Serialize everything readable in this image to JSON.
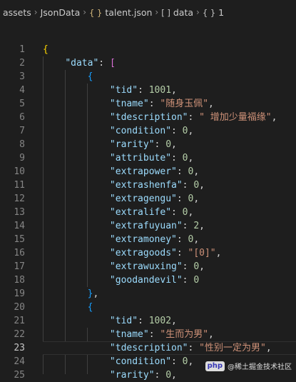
{
  "breadcrumb": {
    "items": [
      {
        "icon": "",
        "label": "assets"
      },
      {
        "icon": "",
        "label": "JsonData"
      },
      {
        "icon": "{ }",
        "label": "talent.json"
      },
      {
        "icon": "[ ]",
        "label": "data"
      },
      {
        "icon": "{ }",
        "label": "1"
      }
    ],
    "separator": "›"
  },
  "editor": {
    "active_line": 23,
    "lines": [
      {
        "n": "1",
        "t": [
          [
            "b1",
            "{"
          ]
        ]
      },
      {
        "n": "2",
        "t": [
          [
            "p",
            "    "
          ],
          [
            "k",
            "\"data\""
          ],
          [
            "p",
            ": "
          ],
          [
            "b2",
            "["
          ]
        ]
      },
      {
        "n": "3",
        "t": [
          [
            "p",
            "        "
          ],
          [
            "b3",
            "{"
          ]
        ]
      },
      {
        "n": "4",
        "t": [
          [
            "p",
            "            "
          ],
          [
            "k",
            "\"tid\""
          ],
          [
            "p",
            ": "
          ],
          [
            "n",
            "1001"
          ],
          [
            "p",
            ","
          ]
        ]
      },
      {
        "n": "5",
        "t": [
          [
            "p",
            "            "
          ],
          [
            "k",
            "\"tname\""
          ],
          [
            "p",
            ": "
          ],
          [
            "s",
            "\"随身玉佩\""
          ],
          [
            "p",
            ","
          ]
        ]
      },
      {
        "n": "6",
        "t": [
          [
            "p",
            "            "
          ],
          [
            "k",
            "\"tdescription\""
          ],
          [
            "p",
            ": "
          ],
          [
            "s",
            "\" 增加少量福缘\""
          ],
          [
            "p",
            ","
          ]
        ]
      },
      {
        "n": "7",
        "t": [
          [
            "p",
            "            "
          ],
          [
            "k",
            "\"condition\""
          ],
          [
            "p",
            ": "
          ],
          [
            "n",
            "0"
          ],
          [
            "p",
            ","
          ]
        ]
      },
      {
        "n": "8",
        "t": [
          [
            "p",
            "            "
          ],
          [
            "k",
            "\"rarity\""
          ],
          [
            "p",
            ": "
          ],
          [
            "n",
            "0"
          ],
          [
            "p",
            ","
          ]
        ]
      },
      {
        "n": "9",
        "t": [
          [
            "p",
            "            "
          ],
          [
            "k",
            "\"attribute\""
          ],
          [
            "p",
            ": "
          ],
          [
            "n",
            "0"
          ],
          [
            "p",
            ","
          ]
        ]
      },
      {
        "n": "10",
        "t": [
          [
            "p",
            "            "
          ],
          [
            "k",
            "\"extrapower\""
          ],
          [
            "p",
            ": "
          ],
          [
            "n",
            "0"
          ],
          [
            "p",
            ","
          ]
        ]
      },
      {
        "n": "11",
        "t": [
          [
            "p",
            "            "
          ],
          [
            "k",
            "\"extrashenfa\""
          ],
          [
            "p",
            ": "
          ],
          [
            "n",
            "0"
          ],
          [
            "p",
            ","
          ]
        ]
      },
      {
        "n": "12",
        "t": [
          [
            "p",
            "            "
          ],
          [
            "k",
            "\"extragengu\""
          ],
          [
            "p",
            ": "
          ],
          [
            "n",
            "0"
          ],
          [
            "p",
            ","
          ]
        ]
      },
      {
        "n": "13",
        "t": [
          [
            "p",
            "            "
          ],
          [
            "k",
            "\"extralife\""
          ],
          [
            "p",
            ": "
          ],
          [
            "n",
            "0"
          ],
          [
            "p",
            ","
          ]
        ]
      },
      {
        "n": "14",
        "t": [
          [
            "p",
            "            "
          ],
          [
            "k",
            "\"extrafuyuan\""
          ],
          [
            "p",
            ": "
          ],
          [
            "n",
            "2"
          ],
          [
            "p",
            ","
          ]
        ]
      },
      {
        "n": "15",
        "t": [
          [
            "p",
            "            "
          ],
          [
            "k",
            "\"extramoney\""
          ],
          [
            "p",
            ": "
          ],
          [
            "n",
            "0"
          ],
          [
            "p",
            ","
          ]
        ]
      },
      {
        "n": "16",
        "t": [
          [
            "p",
            "            "
          ],
          [
            "k",
            "\"extragoods\""
          ],
          [
            "p",
            ": "
          ],
          [
            "s",
            "\"[0]\""
          ],
          [
            "p",
            ","
          ]
        ]
      },
      {
        "n": "17",
        "t": [
          [
            "p",
            "            "
          ],
          [
            "k",
            "\"extrawuxing\""
          ],
          [
            "p",
            ": "
          ],
          [
            "n",
            "0"
          ],
          [
            "p",
            ","
          ]
        ]
      },
      {
        "n": "18",
        "t": [
          [
            "p",
            "            "
          ],
          [
            "k",
            "\"goodandevil\""
          ],
          [
            "p",
            ": "
          ],
          [
            "n",
            "0"
          ]
        ]
      },
      {
        "n": "19",
        "t": [
          [
            "p",
            "        "
          ],
          [
            "b3",
            "}"
          ],
          [
            "p",
            ","
          ]
        ]
      },
      {
        "n": "20",
        "t": [
          [
            "p",
            "        "
          ],
          [
            "b3",
            "{"
          ]
        ]
      },
      {
        "n": "21",
        "t": [
          [
            "p",
            "            "
          ],
          [
            "k",
            "\"tid\""
          ],
          [
            "p",
            ": "
          ],
          [
            "n",
            "1002"
          ],
          [
            "p",
            ","
          ]
        ]
      },
      {
        "n": "22",
        "t": [
          [
            "p",
            "            "
          ],
          [
            "k",
            "\"tname\""
          ],
          [
            "p",
            ": "
          ],
          [
            "s",
            "\"生而为男\""
          ],
          [
            "p",
            ","
          ]
        ]
      },
      {
        "n": "23",
        "t": [
          [
            "p",
            "            "
          ],
          [
            "k",
            "\"tdescription\""
          ],
          [
            "p",
            ": "
          ],
          [
            "s",
            "\"性别一定为男\""
          ],
          [
            "p",
            ","
          ]
        ]
      },
      {
        "n": "24",
        "t": [
          [
            "p",
            "            "
          ],
          [
            "k",
            "\"condition\""
          ],
          [
            "p",
            ": "
          ],
          [
            "n",
            "0"
          ],
          [
            "p",
            ","
          ]
        ]
      },
      {
        "n": "25",
        "t": [
          [
            "p",
            "            "
          ],
          [
            "k",
            "\"rarity\""
          ],
          [
            "p",
            ": "
          ],
          [
            "n",
            "0"
          ],
          [
            "p",
            ","
          ]
        ]
      }
    ]
  },
  "watermark": {
    "logo": "php",
    "text": "@稀土掘金技术社区"
  }
}
